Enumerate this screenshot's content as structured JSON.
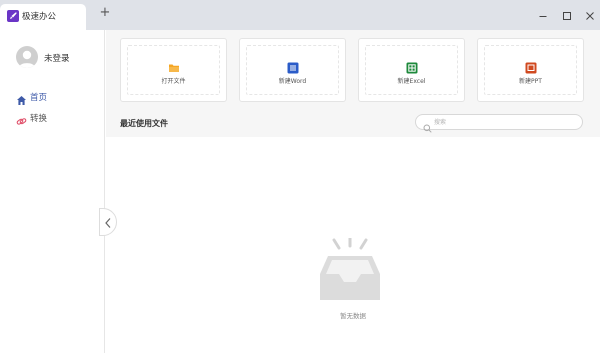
{
  "window": {
    "tab_title": "极速办公",
    "new_tab_symbol": "+",
    "icons": [
      "rocket-icon",
      "minimize-icon",
      "maximize-icon",
      "close-icon"
    ]
  },
  "sidebar": {
    "user_name": "未登录",
    "items": [
      {
        "label": "首页",
        "icon": "home-icon",
        "active": true
      },
      {
        "label": "转换",
        "icon": "convert-icon",
        "active": false
      }
    ]
  },
  "quick_actions": [
    {
      "label": "打开文件",
      "icon": "folder-icon",
      "color": "#f5a623"
    },
    {
      "label": "新建Word",
      "icon": "word-icon",
      "color": "#2b5cc8"
    },
    {
      "label": "新建Excel",
      "icon": "excel-icon",
      "color": "#1e8a3c"
    },
    {
      "label": "新建PPT",
      "icon": "ppt-icon",
      "color": "#d04a20"
    }
  ],
  "recent": {
    "title": "最近使用文件",
    "search_placeholder": "搜索",
    "empty_text": "暂无数据"
  },
  "colors": {
    "accent": "#3e5aa8",
    "brand": "#6a35c6",
    "titlebar": "#dfe2e8"
  }
}
